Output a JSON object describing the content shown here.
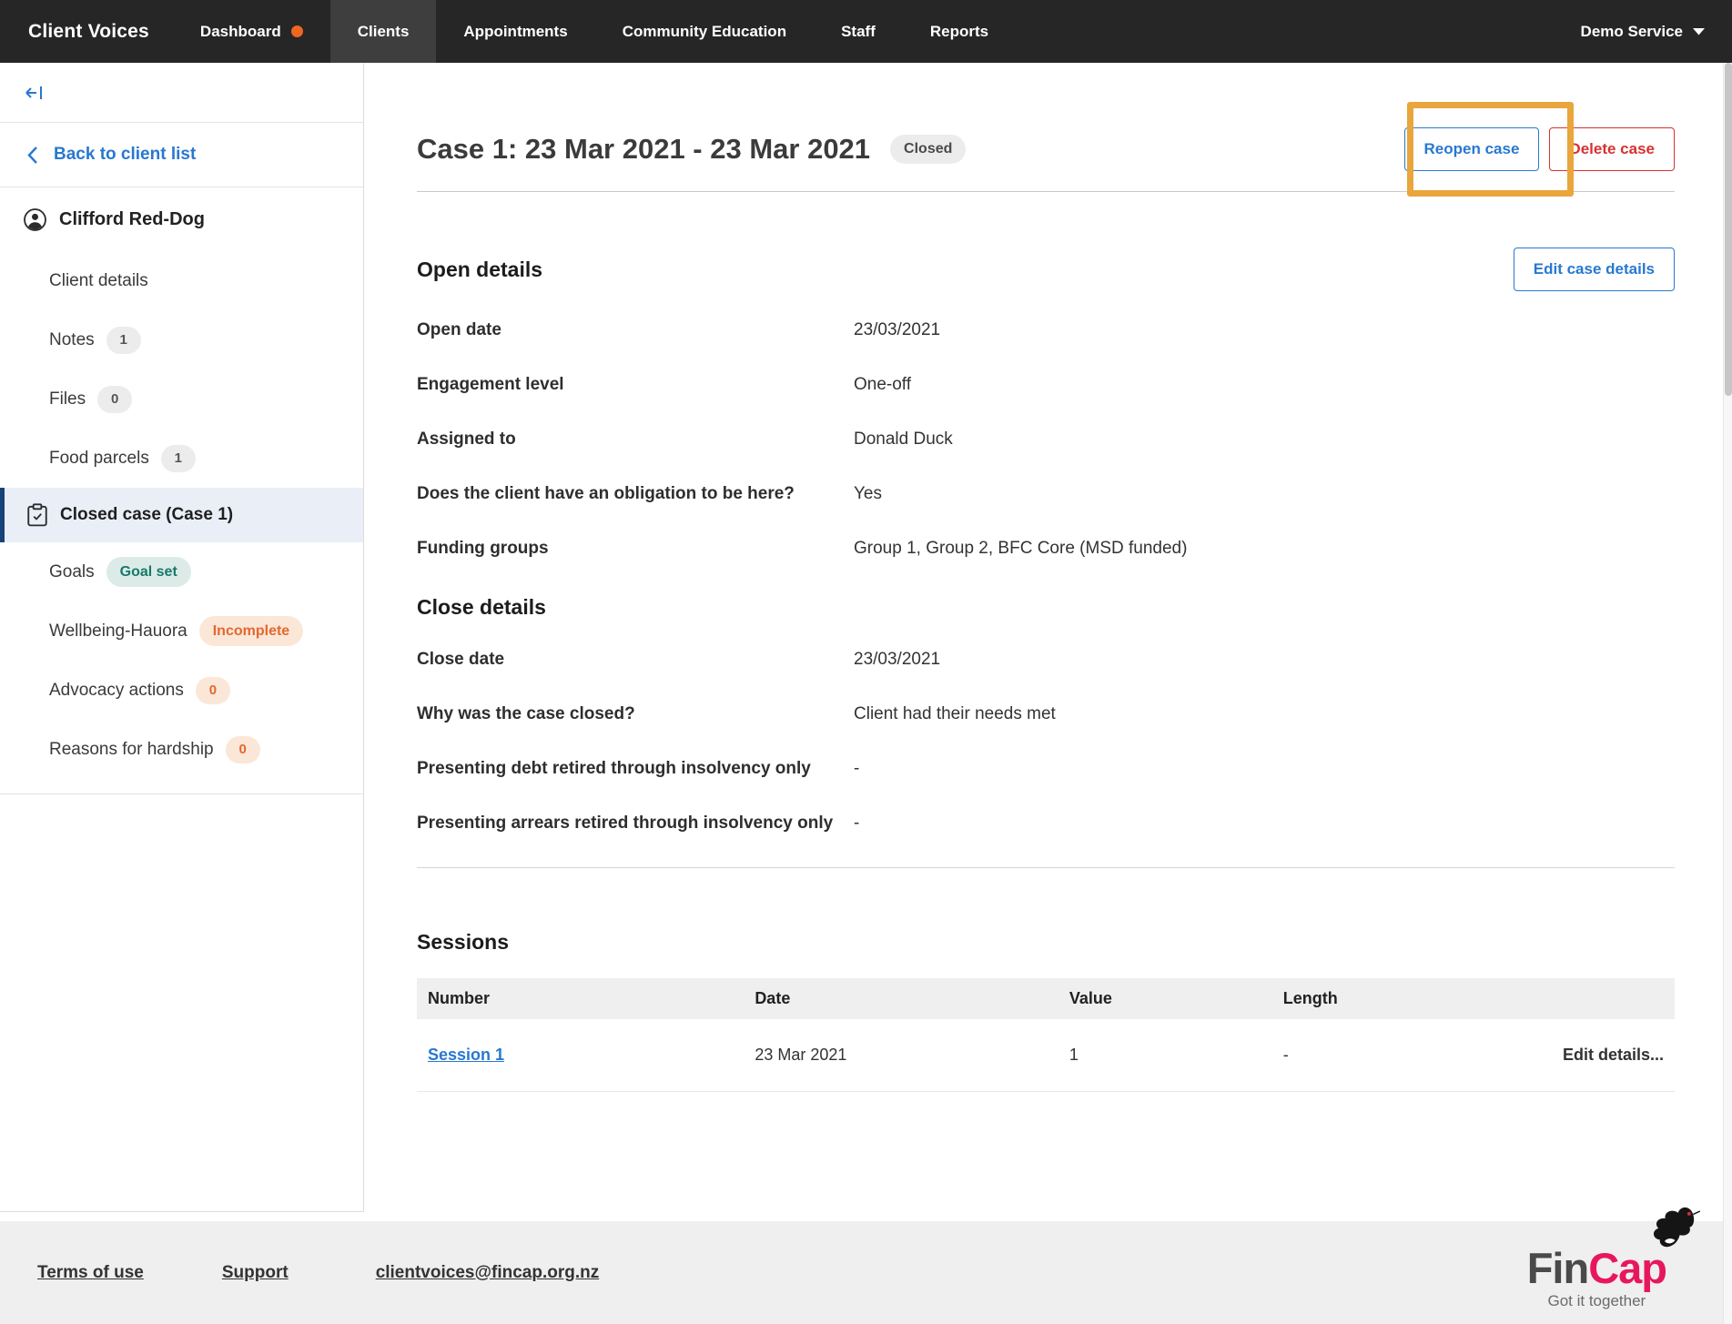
{
  "nav": {
    "brand": "Client Voices",
    "items": [
      {
        "label": "Dashboard",
        "has_notification_dot": true
      },
      {
        "label": "Clients",
        "active": true
      },
      {
        "label": "Appointments"
      },
      {
        "label": "Community Education"
      },
      {
        "label": "Staff"
      },
      {
        "label": "Reports"
      }
    ],
    "service": "Demo Service"
  },
  "sidebar": {
    "back_label": "Back to client list",
    "client_name": "Clifford Red-Dog",
    "items": [
      {
        "label": "Client details"
      },
      {
        "label": "Notes",
        "badge": "1",
        "badge_type": "gray"
      },
      {
        "label": "Files",
        "badge": "0",
        "badge_type": "gray"
      },
      {
        "label": "Food parcels",
        "badge": "1",
        "badge_type": "gray"
      },
      {
        "label": "Closed case (Case 1)",
        "selected": true,
        "icon": "clipboard-check-icon"
      },
      {
        "label": "Goals",
        "badge": "Goal set",
        "badge_type": "teal"
      },
      {
        "label": "Wellbeing-Hauora",
        "badge": "Incomplete",
        "badge_type": "peach"
      },
      {
        "label": "Advocacy actions",
        "badge": "0",
        "badge_type": "peach"
      },
      {
        "label": "Reasons for hardship",
        "badge": "0",
        "badge_type": "peach"
      }
    ]
  },
  "main": {
    "title": "Case 1: 23 Mar 2021 - 23 Mar 2021",
    "status_badge": "Closed",
    "reopen_button": "Reopen case",
    "delete_button": "Delete case",
    "open_details": {
      "heading": "Open details",
      "edit_button": "Edit case details",
      "rows": [
        {
          "label": "Open date",
          "value": "23/03/2021"
        },
        {
          "label": "Engagement level",
          "value": "One-off"
        },
        {
          "label": "Assigned to",
          "value": "Donald Duck"
        },
        {
          "label": "Does the client have an obligation to be here?",
          "value": "Yes"
        },
        {
          "label": "Funding groups",
          "value": "Group 1, Group 2, BFC Core (MSD funded)"
        }
      ]
    },
    "close_details": {
      "heading": "Close details",
      "rows": [
        {
          "label": "Close date",
          "value": "23/03/2021"
        },
        {
          "label": "Why was the case closed?",
          "value": "Client had their needs met"
        },
        {
          "label": "Presenting debt retired through insolvency only",
          "value": "-"
        },
        {
          "label": "Presenting arrears retired through insolvency only",
          "value": "-"
        }
      ]
    },
    "sessions": {
      "heading": "Sessions",
      "columns": [
        "Number",
        "Date",
        "Value",
        "Length"
      ],
      "rows": [
        {
          "number": "Session 1",
          "date": "23 Mar 2021",
          "value": "1",
          "length": "-",
          "edit_label": "Edit details..."
        }
      ]
    }
  },
  "footer": {
    "links": [
      "Terms of use",
      "Support",
      "clientvoices@fincap.org.nz"
    ],
    "logo": {
      "fin": "Fin",
      "cap": "Cap",
      "tagline": "Got it together"
    }
  },
  "icons": {
    "collapse-sidebar-icon": "arrow-to-left-bar",
    "chevron-left-icon": "‹",
    "person-icon": "account-circle",
    "clipboard-check-icon": "clipboard with check",
    "caret-down-icon": "▾",
    "notification-dot": "orange dot",
    "tui-bird-icon": "black tui bird with red eye"
  },
  "colors": {
    "nav_bg": "#262626",
    "nav_active_bg": "#3e3e3e",
    "notification_orange": "#ee6723",
    "accent_blue": "#2878d0",
    "danger_red": "#d93030",
    "selected_item_bg": "#e9eef7",
    "selected_item_border": "#17427a",
    "teal_badge_text": "#17796b",
    "peach_badge_text": "#e4682e",
    "annotation_orange": "#e9a63c",
    "footer_bg": "#efefef",
    "brand_pink": "#e8175d"
  }
}
